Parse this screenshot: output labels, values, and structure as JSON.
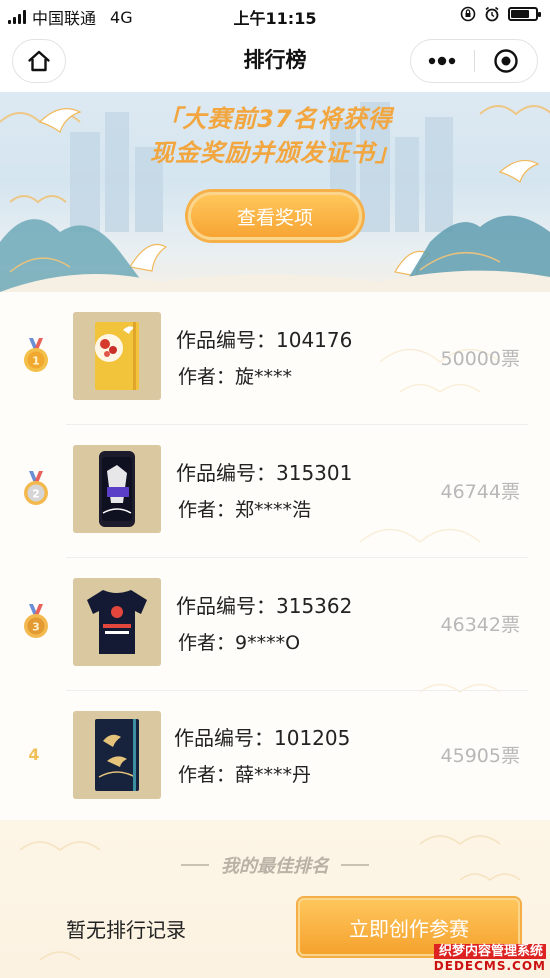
{
  "status_bar": {
    "carrier": "中国联通",
    "network": "4G",
    "time": "上午11:15"
  },
  "nav": {
    "title": "排行榜"
  },
  "banner": {
    "line1": "「大赛前37名将获得",
    "line2": "现金奖励并颁发证书」",
    "button": "查看奖项"
  },
  "ranking": [
    {
      "rank": "1",
      "work_id": "作品编号：104176",
      "author": "作者：旋****",
      "votes": "50000票",
      "medal": "gold-medal"
    },
    {
      "rank": "2",
      "work_id": "作品编号：315301",
      "author": "作者：郑****浩",
      "votes": "46744票",
      "medal": "silver-medal"
    },
    {
      "rank": "3",
      "work_id": "作品编号：315362",
      "author": "作者：9****O",
      "votes": "46342票",
      "medal": "bronze-medal"
    },
    {
      "rank": "4",
      "work_id": "作品编号：101205",
      "author": "作者：薛****丹",
      "votes": "45905票",
      "medal": ""
    }
  ],
  "my_rank": {
    "title": "我的最佳排名",
    "status": "暂无排行记录",
    "button": "立即创作参赛"
  },
  "watermark": {
    "line1": "织梦内容管理系统",
    "line2": "DEDECMS.COM"
  },
  "colors": {
    "accent": "#f5a534",
    "banner_text": "#f2a640",
    "votes": "#b8b8b8",
    "gold": "#f0b93a",
    "silver": "#c9c9c9",
    "bronze": "#e9a43c"
  }
}
